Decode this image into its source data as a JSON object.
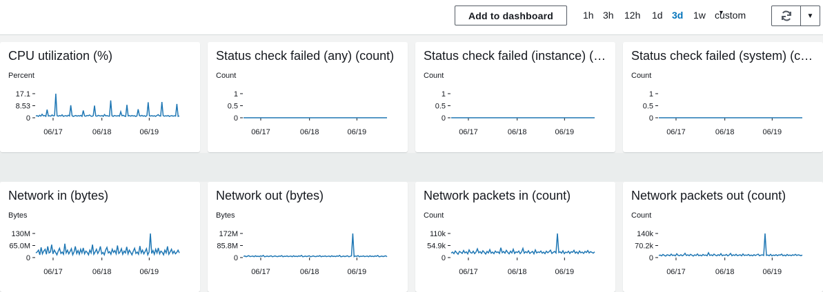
{
  "toolbar": {
    "add_label": "Add to dashboard",
    "ranges": [
      {
        "label": "1h",
        "active": false
      },
      {
        "label": "3h",
        "active": false
      },
      {
        "label": "12h",
        "active": false
      },
      {
        "label": "1d",
        "active": false
      },
      {
        "label": "3d",
        "active": true
      },
      {
        "label": "1w",
        "active": false
      },
      {
        "label": "custom",
        "active": false
      }
    ],
    "refresh_icon": "refresh-icon",
    "dropdown_icon": "caret-down-icon"
  },
  "colors": {
    "line": "#1f77b4",
    "accent": "#0073bb"
  },
  "chart_data": [
    {
      "type": "line",
      "title": "CPU utilization (%)",
      "ylabel": "Percent",
      "yticks": [
        "17.1",
        "8.53",
        "0"
      ],
      "ylim": [
        0,
        17.1
      ],
      "xticks": [
        "06/17",
        "06/18",
        "06/19"
      ],
      "series": [
        {
          "values": [
            1.2,
            1.5,
            1.0,
            1.8,
            1.1,
            2.5,
            1.3,
            1.6,
            1.0,
            5.8,
            1.2,
            1.4,
            1.1,
            2.0,
            1.3,
            1.5,
            17.1,
            1.4,
            1.1,
            1.6,
            1.2,
            2.1,
            1.0,
            1.3,
            1.5,
            1.1,
            1.8,
            1.2,
            8.9,
            1.4,
            1.0,
            1.3,
            1.6,
            1.1,
            1.5,
            1.2,
            1.7,
            1.0,
            5.2,
            1.3,
            1.1,
            1.6,
            1.4,
            2.0,
            1.2,
            1.0,
            1.5,
            8.6,
            1.3,
            1.1,
            1.7,
            1.4,
            1.2,
            1.6,
            1.0,
            2.3,
            1.3,
            1.5,
            1.2,
            1.1,
            12.3,
            1.4,
            1.0,
            1.6,
            1.3,
            1.2,
            1.5,
            1.1,
            4.3,
            1.4,
            1.7,
            1.2,
            1.0,
            9.2,
            1.3,
            1.5,
            1.1,
            1.6,
            1.2,
            1.4,
            1.0,
            1.3,
            6.0,
            1.5,
            1.2,
            1.7,
            1.1,
            1.4,
            1.0,
            1.6,
            11.0,
            1.3,
            1.2,
            1.5,
            1.1,
            1.4,
            1.0,
            1.6,
            2.2,
            1.3,
            1.2,
            11.2,
            1.5,
            1.1,
            1.4,
            1.2,
            1.6,
            1.0,
            1.3,
            1.5,
            1.1,
            1.4,
            1.2,
            9.8,
            1.0,
            1.3
          ]
        }
      ]
    },
    {
      "type": "line",
      "title": "Status check failed (any) (count)",
      "ylabel": "Count",
      "yticks": [
        "1",
        "0.5",
        "0"
      ],
      "ylim": [
        0,
        1
      ],
      "xticks": [
        "06/17",
        "06/18",
        "06/19"
      ],
      "series": [
        {
          "values": [
            0,
            0,
            0,
            0,
            0,
            0,
            0,
            0,
            0,
            0
          ]
        }
      ]
    },
    {
      "type": "line",
      "title": "Status check failed (instance) (count)",
      "ylabel": "Count",
      "yticks": [
        "1",
        "0.5",
        "0"
      ],
      "ylim": [
        0,
        1
      ],
      "xticks": [
        "06/17",
        "06/18",
        "06/19"
      ],
      "series": [
        {
          "values": [
            0,
            0,
            0,
            0,
            0,
            0,
            0,
            0,
            0,
            0
          ]
        }
      ]
    },
    {
      "type": "line",
      "title": "Status check failed (system) (count)",
      "ylabel": "Count",
      "yticks": [
        "1",
        "0.5",
        "0"
      ],
      "ylim": [
        0,
        1
      ],
      "xticks": [
        "06/17",
        "06/18",
        "06/19"
      ],
      "series": [
        {
          "values": [
            0,
            0,
            0,
            0,
            0,
            0,
            0,
            0,
            0,
            0
          ]
        }
      ]
    },
    {
      "type": "line",
      "title": "Network in (bytes)",
      "ylabel": "Bytes",
      "yticks": [
        "130M",
        "65.0M",
        "0"
      ],
      "ylim": [
        0,
        130
      ],
      "xticks": [
        "06/17",
        "06/18",
        "06/19"
      ],
      "series": [
        {
          "values": [
            25,
            30,
            40,
            15,
            55,
            20,
            35,
            45,
            18,
            60,
            25,
            30,
            70,
            20,
            40,
            28,
            15,
            35,
            50,
            22,
            30,
            18,
            75,
            25,
            40,
            20,
            33,
            48,
            15,
            30,
            60,
            22,
            38,
            18,
            45,
            25,
            52,
            20,
            35,
            28,
            15,
            40,
            25,
            70,
            18,
            30,
            45,
            22,
            35,
            60,
            20,
            28,
            15,
            40,
            55,
            25,
            32,
            18,
            45,
            28,
            38,
            20,
            65,
            22,
            30,
            48,
            18,
            35,
            25,
            58,
            20,
            40,
            28,
            15,
            35,
            50,
            22,
            30,
            18,
            62,
            25,
            40,
            20,
            33,
            48,
            15,
            30,
            130,
            22,
            38,
            18,
            45,
            25,
            52,
            20,
            35,
            28,
            15,
            40,
            25,
            60,
            18,
            30,
            45,
            22,
            35,
            20,
            28,
            40,
            25
          ]
        }
      ]
    },
    {
      "type": "line",
      "title": "Network out (bytes)",
      "ylabel": "Bytes",
      "yticks": [
        "172M",
        "85.8M",
        "0"
      ],
      "ylim": [
        0,
        172
      ],
      "xticks": [
        "06/17",
        "06/18",
        "06/19"
      ],
      "series": [
        {
          "values": [
            8,
            12,
            6,
            10,
            14,
            7,
            9,
            11,
            6,
            13,
            8,
            10,
            7,
            12,
            9,
            15,
            6,
            8,
            11,
            7,
            10,
            13,
            6,
            9,
            12,
            8,
            7,
            11,
            9,
            14,
            6,
            10,
            8,
            12,
            7,
            9,
            11,
            6,
            13,
            8,
            10,
            7,
            12,
            9,
            15,
            6,
            8,
            11,
            7,
            10,
            13,
            6,
            9,
            12,
            8,
            7,
            11,
            9,
            14,
            6,
            10,
            8,
            12,
            7,
            9,
            11,
            6,
            13,
            8,
            10,
            7,
            12,
            9,
            15,
            6,
            8,
            11,
            7,
            10,
            13,
            6,
            9,
            12,
            172,
            7,
            11,
            9,
            14,
            6,
            10,
            8,
            12,
            7,
            9,
            11,
            6,
            13,
            8,
            10,
            7,
            12,
            9,
            15,
            6,
            8,
            11,
            7,
            10,
            13,
            6
          ]
        }
      ]
    },
    {
      "type": "line",
      "title": "Network packets in (count)",
      "ylabel": "Count",
      "yticks": [
        "110k",
        "54.9k",
        "0"
      ],
      "ylim": [
        0,
        110
      ],
      "xticks": [
        "06/17",
        "06/18",
        "06/19"
      ],
      "series": [
        {
          "values": [
            20,
            25,
            18,
            30,
            22,
            15,
            28,
            24,
            19,
            32,
            21,
            26,
            17,
            35,
            23,
            20,
            29,
            18,
            25,
            40,
            22,
            27,
            19,
            31,
            24,
            16,
            28,
            21,
            36,
            20,
            25,
            18,
            30,
            23,
            26,
            19,
            45,
            22,
            28,
            20,
            33,
            24,
            17,
            29,
            21,
            38,
            19,
            26,
            23,
            30,
            18,
            25,
            42,
            20,
            27,
            22,
            31,
            19,
            24,
            28,
            17,
            35,
            21,
            26,
            23,
            30,
            20,
            25,
            18,
            29,
            22,
            27,
            34,
            19,
            24,
            28,
            21,
            110,
            23,
            26,
            20,
            31,
            18,
            25,
            22,
            29,
            19,
            27,
            24,
            33,
            20,
            26,
            18,
            30,
            22,
            25,
            19,
            28,
            23,
            32,
            21,
            27,
            24,
            20,
            26
          ]
        }
      ]
    },
    {
      "type": "line",
      "title": "Network packets out (count)",
      "ylabel": "Count",
      "yticks": [
        "140k",
        "70.2k",
        "0"
      ],
      "ylim": [
        0,
        140
      ],
      "xticks": [
        "06/17",
        "06/18",
        "06/19"
      ],
      "series": [
        {
          "values": [
            12,
            15,
            10,
            18,
            13,
            9,
            16,
            14,
            11,
            20,
            12,
            15,
            10,
            22,
            13,
            11,
            17,
            10,
            15,
            25,
            12,
            16,
            11,
            19,
            14,
            9,
            16,
            12,
            21,
            11,
            15,
            10,
            18,
            13,
            15,
            11,
            28,
            12,
            16,
            11,
            20,
            14,
            10,
            17,
            12,
            23,
            11,
            15,
            13,
            18,
            10,
            15,
            24,
            11,
            16,
            12,
            19,
            11,
            14,
            16,
            10,
            21,
            12,
            15,
            13,
            18,
            11,
            15,
            10,
            17,
            12,
            16,
            20,
            11,
            14,
            16,
            12,
            140,
            13,
            15,
            11,
            19,
            10,
            15,
            12,
            17,
            11,
            16,
            14,
            20,
            11,
            15,
            10,
            18,
            12,
            15,
            11,
            16,
            13,
            19,
            12,
            16,
            14,
            11,
            15
          ]
        }
      ]
    }
  ]
}
